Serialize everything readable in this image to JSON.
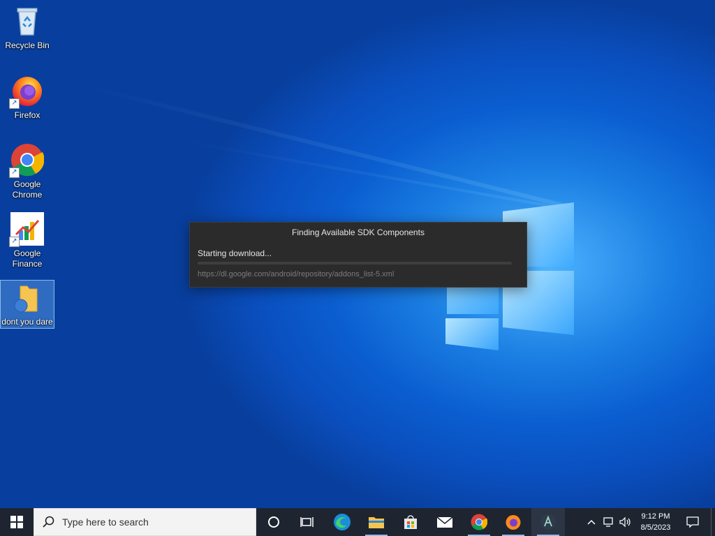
{
  "desktop_icons": [
    {
      "label": "Recycle Bin",
      "icon": "recycle-bin-icon"
    },
    {
      "label": "Firefox",
      "icon": "firefox-icon"
    },
    {
      "label": "Google Chrome",
      "icon": "chrome-icon"
    },
    {
      "label": "Google Finance",
      "icon": "google-finance-icon"
    },
    {
      "label": "dont you dare",
      "icon": "folder-icon"
    }
  ],
  "dialog": {
    "title": "Finding Available SDK Components",
    "status": "Starting download...",
    "url": "https://dl.google.com/android/repository/addons_list-5.xml",
    "progress": 0
  },
  "taskbar": {
    "search_placeholder": "Type here to search",
    "apps": [
      "start-icon",
      "cortana-icon",
      "task-view-icon",
      "edge-icon",
      "file-explorer-icon",
      "store-icon",
      "mail-icon",
      "chrome-icon",
      "firefox-icon",
      "android-studio-icon"
    ]
  },
  "tray": {
    "time": "9:12 PM",
    "date": "8/5/2023"
  },
  "colors": {
    "taskbar": "#1e2530",
    "dialog_bg": "#2b2b2b",
    "wallpaper": "#0b5ed0"
  }
}
